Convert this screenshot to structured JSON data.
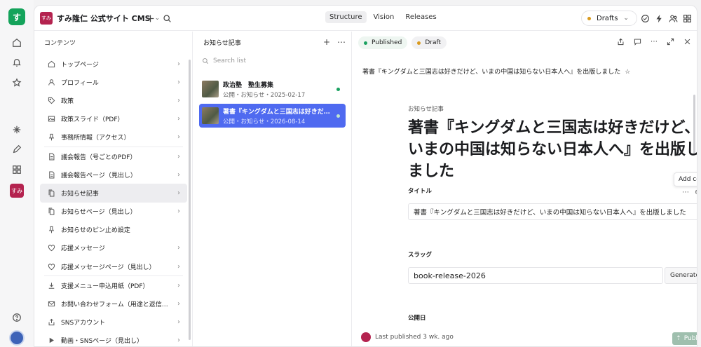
{
  "rail": {
    "logo": "す",
    "workspace_badge": "すみ"
  },
  "topbar": {
    "workspace_badge": "すみ",
    "workspace_name": "すみ隆仁 公式サイト CMS",
    "tabs": [
      {
        "label": "Structure",
        "active": true
      },
      {
        "label": "Vision",
        "active": false
      },
      {
        "label": "Releases",
        "active": false
      }
    ],
    "drafts_label": "Drafts"
  },
  "content_pane": {
    "title": "コンテンツ",
    "items": [
      {
        "label": "トップページ",
        "icon": "home-icon"
      },
      {
        "label": "プロフィール",
        "icon": "user-icon"
      },
      {
        "label": "政策",
        "icon": "tag-icon"
      },
      {
        "label": "政策スライド（PDF）",
        "icon": "image-icon"
      },
      {
        "label": "事務所情報（アクセス）",
        "icon": "pin-icon"
      },
      {
        "label": "議会報告（号ごとのPDF）",
        "icon": "document-icon"
      },
      {
        "label": "議会報告ページ（見出し）",
        "icon": "document-icon"
      },
      {
        "label": "お知らせ記事",
        "icon": "documents-icon",
        "selected": true
      },
      {
        "label": "お知らせページ（見出し）",
        "icon": "documents-icon"
      },
      {
        "label": "お知らせのピン止め設定",
        "icon": "pin-icon"
      },
      {
        "label": "応援メッセージ",
        "icon": "heart-icon"
      },
      {
        "label": "応援メッセージページ（見出し）",
        "icon": "heart-icon"
      },
      {
        "label": "支援メニュー申込用紙（PDF）",
        "icon": "download-icon"
      },
      {
        "label": "お問い合わせフォーム（用途と返信…",
        "icon": "mail-icon"
      },
      {
        "label": "SNSアカウント",
        "icon": "share-icon"
      },
      {
        "label": "動画・SNSページ（見出し）",
        "icon": "play-icon"
      }
    ]
  },
  "list_pane": {
    "title": "お知らせ記事",
    "search_placeholder": "Search list",
    "docs": [
      {
        "title": "政治塾　塾生募集",
        "subtitle": "公開・お知らせ・2025-02-17",
        "selected": false
      },
      {
        "title": "著書『キングダムと三国志は好きだけど、…",
        "subtitle": "公開・お知らせ・2026-08-14",
        "selected": true
      }
    ]
  },
  "editor": {
    "status_pills": [
      {
        "label": "Published",
        "color": "#1aa160"
      },
      {
        "label": "Draft",
        "color": "#d99a1e"
      }
    ],
    "doc_title": "著書『キングダムと三国志は好きだけど、いまの中国は知らない日本人へ』を出版しました",
    "eyebrow": "お知らせ記事",
    "heading": "著書『キングダムと三国志は好きだけど、いまの中国は知らない日本人へ』を出版しました",
    "tooltip": "Add comment",
    "fields": {
      "title_label": "タイトル",
      "title_value": "著書『キングダムと三国志は好きだけど、いまの中国は知らない日本人へ』を出版しました",
      "slug_label": "スラッグ",
      "slug_value": "book-release-2026",
      "generate_label": "Generate",
      "date_label": "公開日"
    },
    "footer": {
      "last_published": "Last published 3 wk. ago",
      "publish_label": "Publish"
    }
  },
  "colors": {
    "brand_green": "#14a35b",
    "accent_blue": "#4f6af0",
    "workspace": "#b4234f"
  }
}
